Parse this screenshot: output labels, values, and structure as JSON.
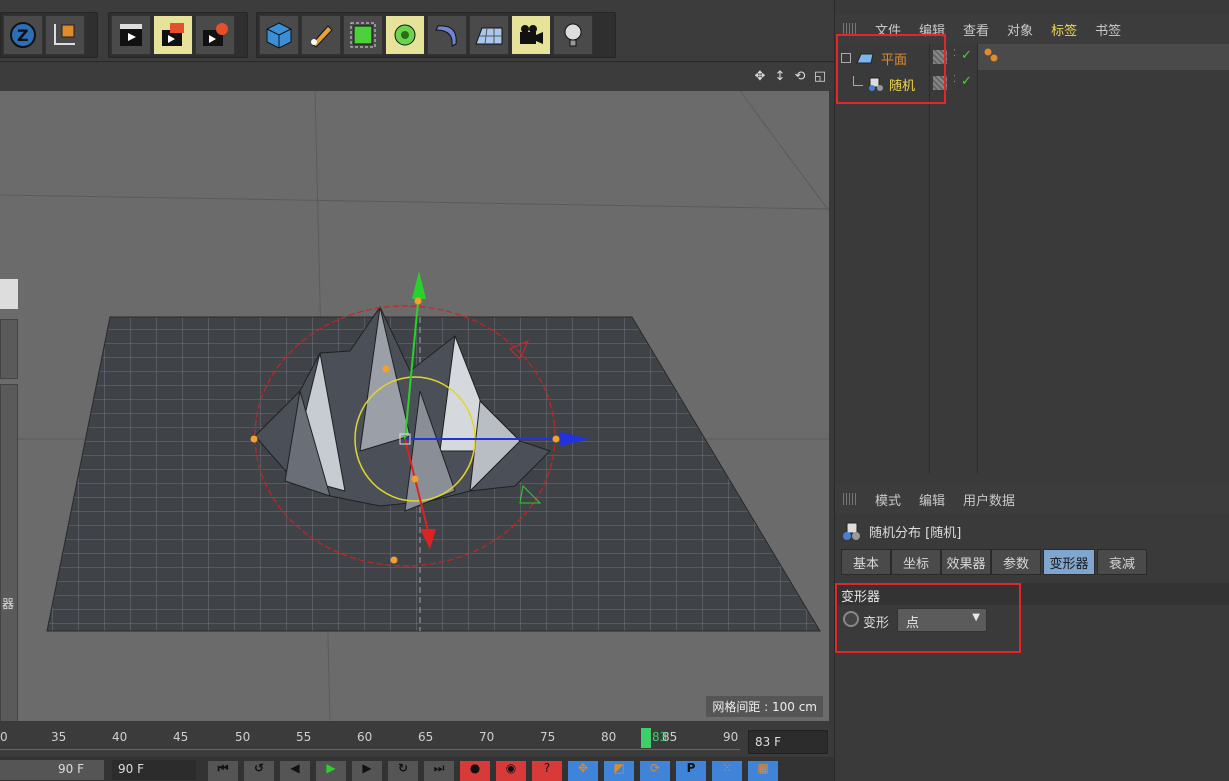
{
  "toolbar": {
    "groups": [
      {
        "name": "axis-tools",
        "buttons": [
          "z-axis-icon",
          "coordinate-icon"
        ]
      },
      {
        "name": "render-tools",
        "buttons": [
          "render-view-icon",
          "render-picture-queue-icon",
          "render-settings-icon"
        ]
      },
      {
        "name": "object-tools",
        "buttons": [
          "cube-icon",
          "pen-icon",
          "subdivision-icon",
          "cloner-icon",
          "bend-deformer-icon",
          "floor-icon",
          "camera-icon",
          "light-icon"
        ]
      }
    ]
  },
  "viewport": {
    "grid_spacing_label": "网格间距 : 100 cm",
    "side_label": "器"
  },
  "timeline": {
    "ticks": [
      "0",
      "35",
      "40",
      "45",
      "50",
      "55",
      "60",
      "65",
      "70",
      "75",
      "80",
      "85",
      "90"
    ],
    "current_frame": "83",
    "frame_field": "83 F",
    "end_field": "90 F",
    "end_field2": "90 F"
  },
  "object_manager": {
    "menu": [
      "文件",
      "编辑",
      "查看",
      "对象",
      "标签",
      "书签"
    ],
    "active_menu": "标签",
    "objects": [
      {
        "name": "平面",
        "icon": "plane-icon",
        "color": "#e08a2a"
      },
      {
        "name": "随机",
        "icon": "random-effector-icon",
        "color": "#f2d64f"
      }
    ]
  },
  "attribute_manager": {
    "menu": [
      "模式",
      "编辑",
      "用户数据"
    ],
    "object_title": "随机分布 [随机]",
    "tabs": [
      "基本",
      "坐标",
      "效果器",
      "参数",
      "变形器",
      "衰减"
    ],
    "active_tab": "变形器",
    "section_title": "变形器",
    "deform_label": "变形",
    "deform_value": "点"
  },
  "colors": {
    "accent": "#f2d64f",
    "highlight_box": "#e2262a",
    "tab_active": "#7ea6cf"
  }
}
